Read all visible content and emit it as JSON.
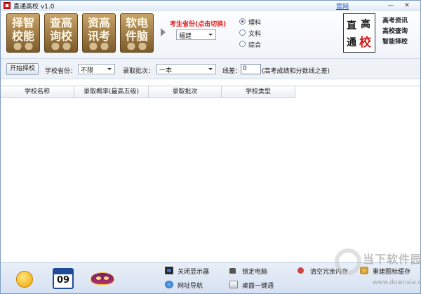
{
  "window": {
    "title": "直通高校 v1.0",
    "official_site_link": "官网",
    "minimize_glyph": "—",
    "close_glyph": "✕"
  },
  "header": {
    "tiles": [
      {
        "line1": "择智",
        "line2": "校能"
      },
      {
        "line1": "查高",
        "line2": "询校"
      },
      {
        "line1": "资高",
        "line2": "讯考"
      },
      {
        "line1": "软电",
        "line2": "件脑"
      }
    ],
    "province_title": "考生省份(点击切换)",
    "province_value": "福建",
    "subject_options": [
      "理科",
      "文科",
      "综合"
    ],
    "subject_selected_index": 0,
    "logo_chars": [
      "直",
      "高",
      "通",
      "校"
    ],
    "promo_lines": [
      "高考资讯",
      "高校查询",
      "智能择校"
    ]
  },
  "filter": {
    "start_button": "开始择校",
    "province_label": "学校省份：",
    "province_value": "不限",
    "batch_label": "录取批次：",
    "batch_value": "一本",
    "diff_label": "线差：",
    "diff_value": "0",
    "diff_note": "(高考成绩和分数线之差)"
  },
  "table": {
    "columns": [
      "学校名称",
      "录取概率(最高五级)",
      "录取批次",
      "学校类型"
    ],
    "rows": []
  },
  "bottom": {
    "calendar_day": "09",
    "tools": [
      {
        "label": "关闭显示器",
        "icon": "monitor-icon"
      },
      {
        "label": "网址导航",
        "icon": "globe-icon"
      },
      {
        "label": "锁定电脑",
        "icon": "lock-icon"
      },
      {
        "label": "桌面一键通",
        "icon": "desktop-icon"
      },
      {
        "label": "清空冗余内存",
        "icon": "memory-clean-icon"
      },
      {
        "label": "重建图标缓存",
        "icon": "rebuild-icon"
      }
    ]
  },
  "watermark": {
    "title": "当下软件园",
    "url": "www.downxia.com"
  },
  "colors": {
    "accent_red": "#e02020",
    "link_blue": "#1c55c6",
    "tile_brown": "#7b5a2a"
  }
}
